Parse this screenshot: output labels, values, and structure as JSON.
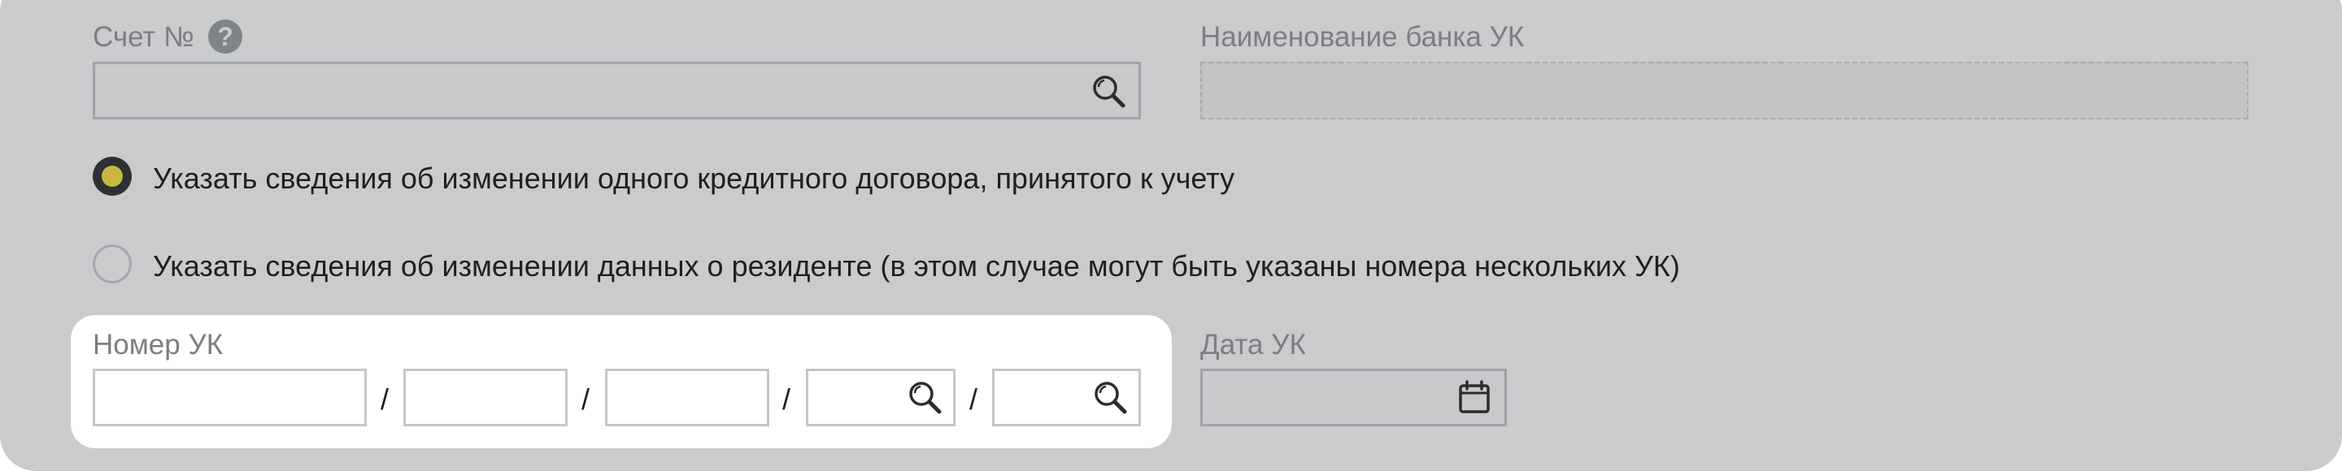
{
  "account": {
    "label": "Счет №",
    "help_icon": "?",
    "value": ""
  },
  "bank_name": {
    "label": "Наименование банка УК",
    "value": ""
  },
  "options": [
    {
      "label": "Указать сведения об изменении одного кредитного договора, принятого к учету",
      "selected": true
    },
    {
      "label": "Указать сведения об изменении данных о резиденте (в этом случае могут быть указаны номера нескольких УК)",
      "selected": false
    }
  ],
  "uk_number": {
    "label": "Номер УК",
    "separator": "/",
    "parts": [
      "",
      "",
      "",
      "",
      ""
    ]
  },
  "uk_date": {
    "label": "Дата УК",
    "value": ""
  },
  "icons": {
    "search": "search-icon",
    "calendar": "calendar-icon",
    "help": "help-icon"
  },
  "colors": {
    "panel_bg": "#cacbcd",
    "radio_selected_fill": "#c6b845",
    "radio_selected_ring": "#2f3033",
    "label_text": "#7c7e82",
    "body_text": "#1e1f21"
  }
}
